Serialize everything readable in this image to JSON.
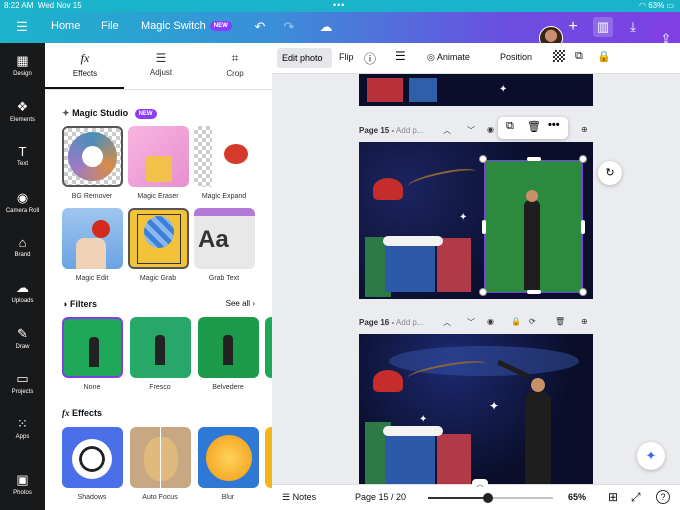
{
  "status": {
    "time": "8:22 AM",
    "date": "Wed Nov 15",
    "battery": "63%"
  },
  "topbar": {
    "home": "Home",
    "file": "File",
    "magic_switch": "Magic Switch",
    "magic_badge": "NEW"
  },
  "rail": [
    "Design",
    "Elements",
    "Text",
    "Camera Roll",
    "Brand",
    "Uploads",
    "Draw",
    "Projects",
    "Apps",
    "Photos"
  ],
  "tabs": [
    "Effects",
    "Adjust",
    "Crop"
  ],
  "magic_studio": {
    "title": "Magic Studio",
    "badge": "NEW",
    "items": [
      "BG Remover",
      "Magic Eraser",
      "Magic Expand",
      "Magic Edit",
      "Magic Grab",
      "Grab Text"
    ]
  },
  "filters": {
    "title": "Filters",
    "see_all": "See all",
    "items": [
      "None",
      "Fresco",
      "Belvedere"
    ]
  },
  "effects": {
    "title": "Effects",
    "items": [
      "Shadows",
      "Auto Focus",
      "Blur"
    ]
  },
  "toolbar": {
    "edit_photo": "Edit photo",
    "flip": "Flip",
    "animate": "Animate",
    "position": "Position"
  },
  "pages": [
    {
      "label": "Page 15 -",
      "placeholder": "Add p..."
    },
    {
      "label": "Page 16 -",
      "placeholder": "Add p..."
    }
  ],
  "bottom": {
    "notes": "Notes",
    "page_count": "Page 15 / 20",
    "zoom": "65%",
    "help": "?",
    "zoom_fraction": 0.48
  },
  "colors": {
    "accent": "#8b3dff",
    "rail": "#18191b",
    "selection": "#7e3fe4"
  }
}
